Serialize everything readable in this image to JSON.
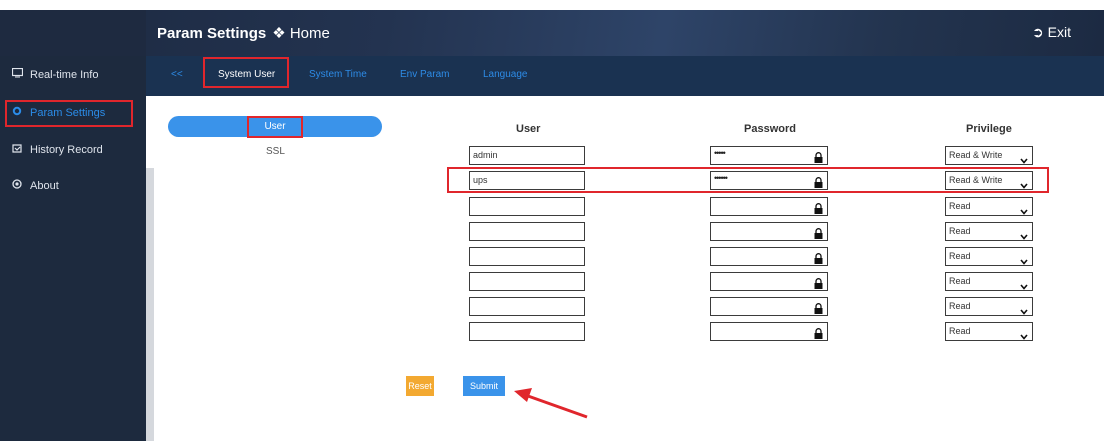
{
  "header": {
    "title": "Param Settings",
    "home_label": "Home",
    "exit_label": "Exit"
  },
  "sidebar": {
    "items": [
      {
        "label": "Real-time Info",
        "icon": "monitor-icon"
      },
      {
        "label": "Param Settings",
        "icon": "gear-icon"
      },
      {
        "label": "History Record",
        "icon": "history-icon"
      },
      {
        "label": "About",
        "icon": "info-icon"
      }
    ]
  },
  "tabs": {
    "back": "<<",
    "items": [
      "System User",
      "System Time",
      "Env Param",
      "Language"
    ],
    "active": "System User"
  },
  "subnav": {
    "items": [
      "User",
      "SSL"
    ],
    "active": "User"
  },
  "table": {
    "headers": {
      "user": "User",
      "password": "Password",
      "privilege": "Privilege"
    },
    "rows": [
      {
        "user": "admin",
        "password": "•••••",
        "privilege": "Read & Write"
      },
      {
        "user": "ups",
        "password": "••••••",
        "privilege": "Read & Write"
      },
      {
        "user": "",
        "password": "",
        "privilege": "Read"
      },
      {
        "user": "",
        "password": "",
        "privilege": "Read"
      },
      {
        "user": "",
        "password": "",
        "privilege": "Read"
      },
      {
        "user": "",
        "password": "",
        "privilege": "Read"
      },
      {
        "user": "",
        "password": "",
        "privilege": "Read"
      },
      {
        "user": "",
        "password": "",
        "privilege": "Read"
      }
    ]
  },
  "actions": {
    "reset_label": "Reset",
    "submit_label": "Submit"
  },
  "colors": {
    "accent": "#3a93ea",
    "highlight": "#e0262c",
    "reset": "#f3a931",
    "sidebar_bg": "#1d2a3e",
    "nav_bg": "#1a3251"
  }
}
